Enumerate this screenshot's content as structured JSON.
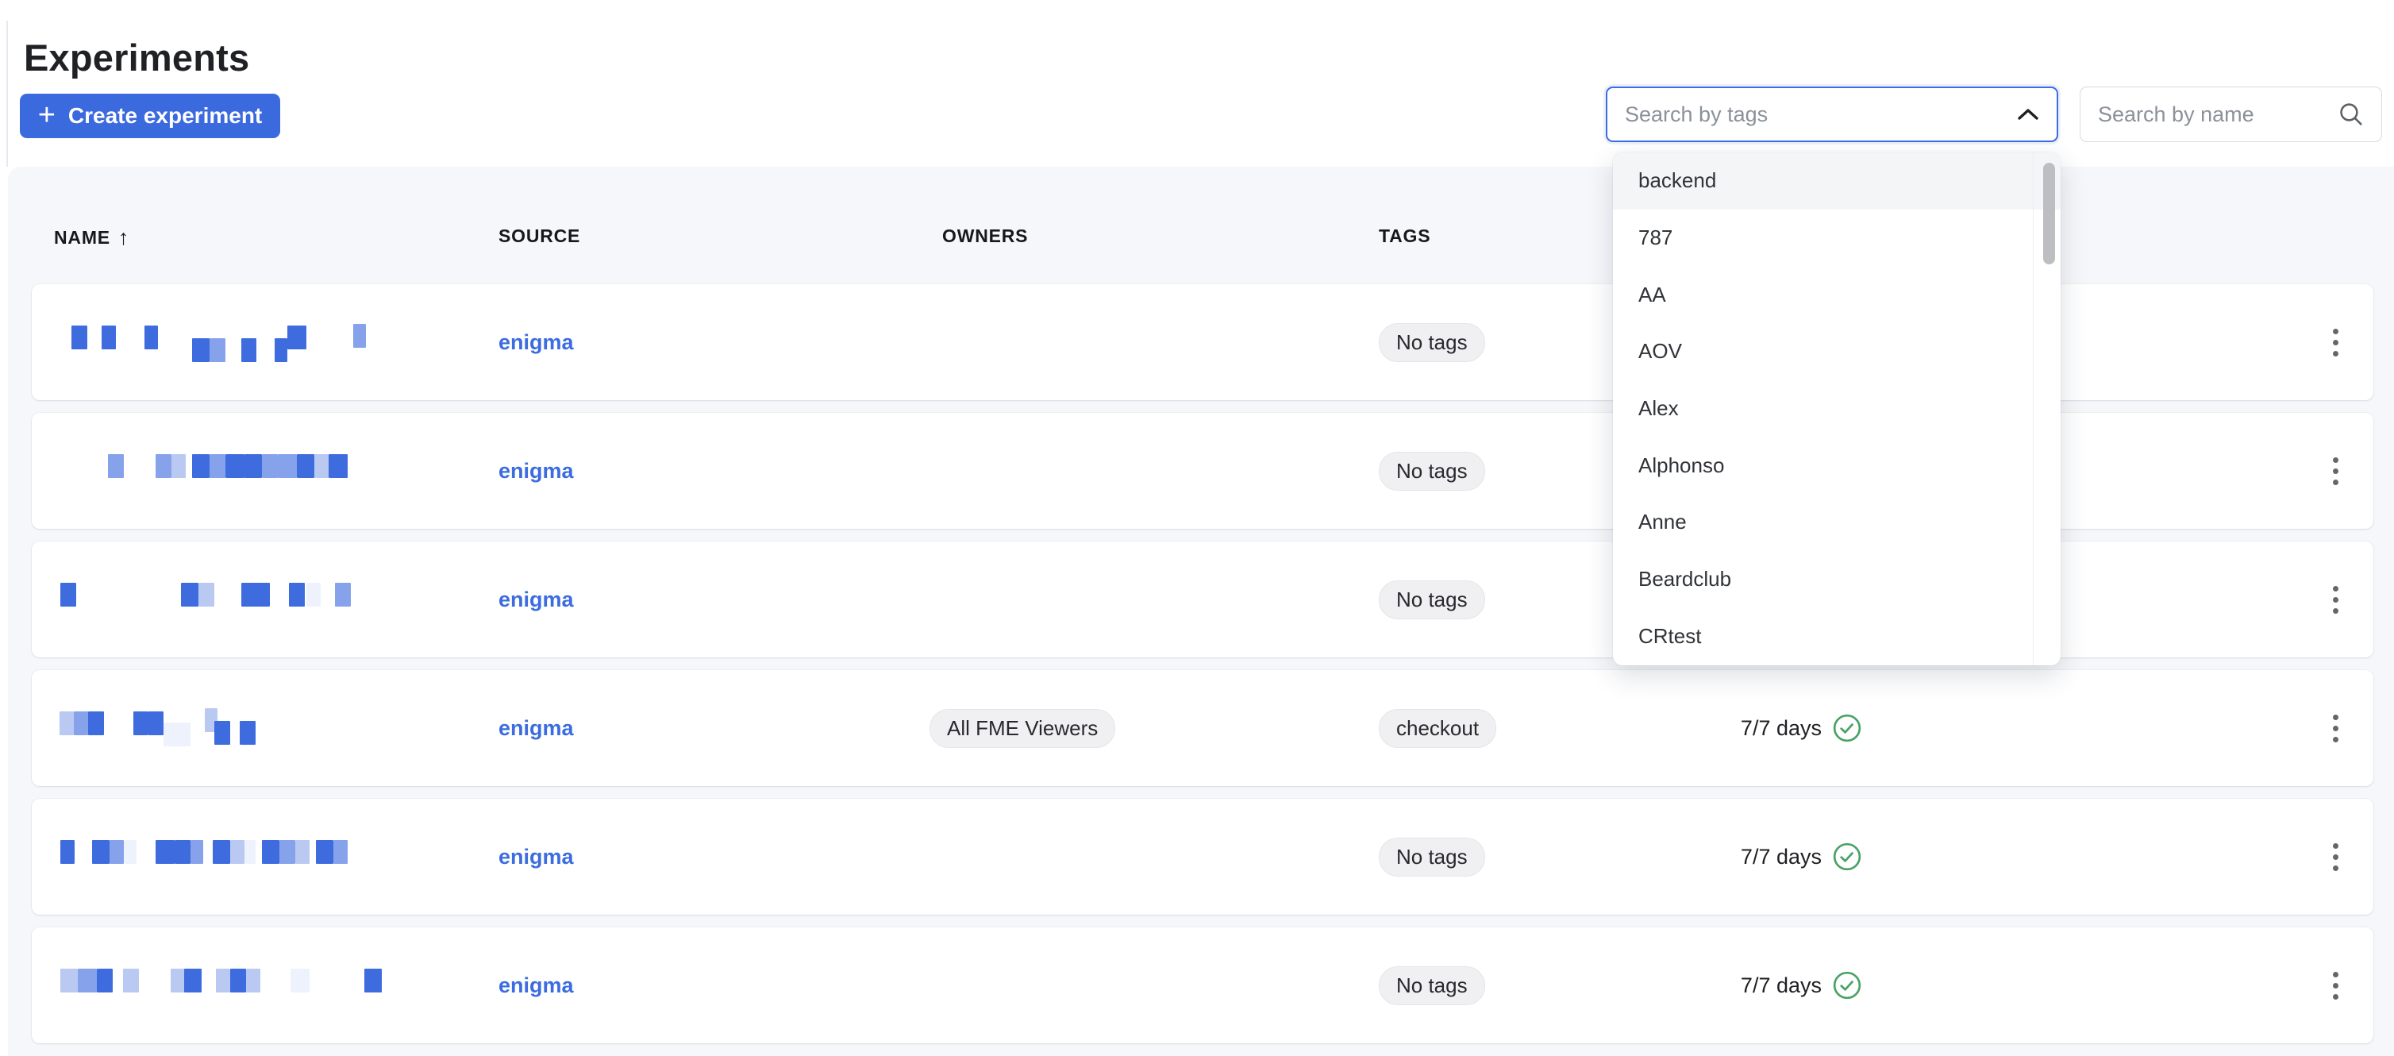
{
  "page": {
    "title": "Experiments"
  },
  "toolbar": {
    "create_label": "Create experiment",
    "plus_glyph": "+",
    "tag_search_placeholder": "Search by tags",
    "name_search_placeholder": "Search by name"
  },
  "tag_dropdown": {
    "items": [
      "backend",
      "787",
      "AA",
      "AOV",
      "Alex",
      "Alphonso",
      "Anne",
      "Beardclub",
      "CRtest"
    ],
    "highlighted": "backend"
  },
  "table": {
    "headers": {
      "name": "NAME",
      "source": "SOURCE",
      "owners": "OWNERS",
      "tags": "TAGS"
    },
    "sort_icon": "↑",
    "no_tags_label": "No tags",
    "rows": [
      {
        "source": "enigma",
        "owners": [],
        "tags": [],
        "days": "",
        "redaction": [
          [
            50,
            0,
            20,
            3
          ],
          [
            88,
            0,
            18,
            3
          ],
          [
            142,
            0,
            17,
            3
          ],
          [
            202,
            16,
            22,
            3
          ],
          [
            224,
            16,
            20,
            2
          ],
          [
            264,
            16,
            19,
            3
          ],
          [
            306,
            16,
            16,
            3
          ],
          [
            322,
            0,
            24,
            3
          ],
          [
            405,
            -2,
            16,
            2
          ]
        ]
      },
      {
        "source": "enigma",
        "owners": [],
        "tags": [],
        "days": "",
        "redaction": [
          [
            96,
            0,
            20,
            2
          ],
          [
            156,
            0,
            20,
            2
          ],
          [
            176,
            0,
            18,
            1
          ],
          [
            202,
            0,
            22,
            3
          ],
          [
            224,
            0,
            20,
            2
          ],
          [
            244,
            0,
            24,
            3
          ],
          [
            268,
            0,
            22,
            3
          ],
          [
            290,
            0,
            20,
            2
          ],
          [
            310,
            0,
            24,
            2
          ],
          [
            334,
            0,
            22,
            3
          ],
          [
            356,
            0,
            18,
            1
          ],
          [
            374,
            0,
            24,
            3
          ]
        ]
      },
      {
        "source": "enigma",
        "owners": [],
        "tags": [],
        "days": "",
        "redaction": [
          [
            36,
            0,
            20,
            3
          ],
          [
            188,
            0,
            22,
            3
          ],
          [
            210,
            0,
            20,
            1
          ],
          [
            264,
            0,
            36,
            3
          ],
          [
            324,
            0,
            20,
            3
          ],
          [
            346,
            0,
            18,
            0
          ],
          [
            382,
            0,
            20,
            2
          ]
        ]
      },
      {
        "source": "enigma",
        "owners": [
          "All FME Viewers"
        ],
        "tags": [
          "checkout"
        ],
        "days": "7/7 days",
        "redaction": [
          [
            35,
            0,
            18,
            1
          ],
          [
            53,
            0,
            18,
            2
          ],
          [
            71,
            0,
            20,
            3
          ],
          [
            128,
            0,
            18,
            3
          ],
          [
            146,
            0,
            20,
            3
          ],
          [
            166,
            14,
            18,
            0
          ],
          [
            184,
            14,
            16,
            0
          ],
          [
            218,
            -4,
            16,
            1
          ],
          [
            230,
            12,
            20,
            3
          ],
          [
            262,
            12,
            20,
            3
          ]
        ]
      },
      {
        "source": "enigma",
        "owners": [],
        "tags": [],
        "days": "7/7 days",
        "redaction": [
          [
            36,
            0,
            18,
            3
          ],
          [
            76,
            0,
            22,
            3
          ],
          [
            98,
            0,
            18,
            2
          ],
          [
            116,
            0,
            16,
            0
          ],
          [
            156,
            0,
            24,
            3
          ],
          [
            180,
            0,
            20,
            3
          ],
          [
            200,
            0,
            16,
            2
          ],
          [
            228,
            0,
            22,
            3
          ],
          [
            250,
            0,
            18,
            1
          ],
          [
            268,
            0,
            14,
            0
          ],
          [
            290,
            0,
            22,
            3
          ],
          [
            312,
            0,
            20,
            2
          ],
          [
            332,
            0,
            18,
            1
          ],
          [
            358,
            0,
            22,
            3
          ],
          [
            380,
            0,
            18,
            2
          ]
        ]
      },
      {
        "source": "enigma",
        "owners": [],
        "tags": [],
        "days": "7/7 days",
        "redaction": [
          [
            36,
            0,
            22,
            1
          ],
          [
            58,
            0,
            24,
            2
          ],
          [
            82,
            0,
            20,
            3
          ],
          [
            115,
            0,
            20,
            1
          ],
          [
            175,
            0,
            18,
            1
          ],
          [
            192,
            0,
            22,
            3
          ],
          [
            232,
            0,
            18,
            1
          ],
          [
            250,
            0,
            20,
            3
          ],
          [
            270,
            0,
            18,
            1
          ],
          [
            326,
            0,
            24,
            0
          ],
          [
            419,
            0,
            22,
            3
          ]
        ]
      }
    ]
  },
  "colors": {
    "accent_blue": "#3b69de",
    "link_blue": "#3b6ce0",
    "success_green": "#4aa263",
    "redaction_shades": [
      "#edf2fc",
      "#b9c9f1",
      "#85a2ea",
      "#3e6cdf"
    ]
  }
}
